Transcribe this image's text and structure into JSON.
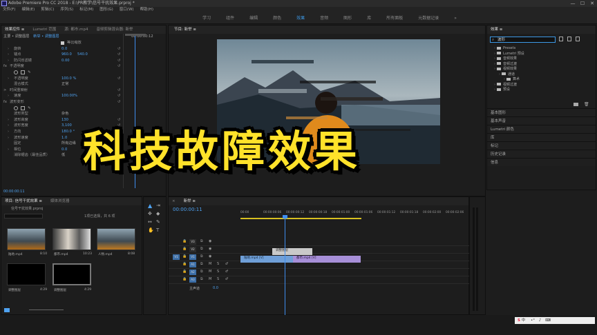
{
  "window": {
    "title": "Adobe Premiere Pro CC 2018 - E:\\PR教学\\信号干扰效果.prproj *",
    "controls": [
      "—",
      "☐",
      "✕"
    ]
  },
  "menu": [
    "文件(F)",
    "编辑(E)",
    "剪辑(C)",
    "序列(S)",
    "标记(M)",
    "图形(G)",
    "窗口(W)",
    "帮助(H)"
  ],
  "workspaces": {
    "items": [
      "学习",
      "组件",
      "编辑",
      "颜色",
      "效果",
      "音频",
      "图形",
      "库",
      "所有面板",
      "元数据记录"
    ],
    "active_index": 4,
    "more": "»"
  },
  "effect_controls": {
    "tabs": [
      "效果控件 ≡",
      "Lumetri 范围",
      "源: 都市.mp4",
      "音频剪辑混合器: 新举"
    ],
    "header_source": "主要 • 调整图层",
    "header_clip": "新举 • 调整图层",
    "header_time": "00:00:00:12",
    "rows": [
      {
        "label": "等比缩放",
        "type": "check"
      },
      {
        "label": "旋转",
        "value": "0.0",
        "arrow": true
      },
      {
        "label": "锚点",
        "value": "960.0",
        "value2": "540.0",
        "arrow": true
      },
      {
        "label": "防闪烁滤镜",
        "value": "0.00",
        "arrow": true
      },
      {
        "label": "不透明度",
        "section": true,
        "fx": "fx"
      },
      {
        "label": "shapes",
        "type": "shapes"
      },
      {
        "label": "不透明度",
        "value": "100.0 %",
        "arrow": true
      },
      {
        "label": "混合模式",
        "plain": "正常"
      },
      {
        "label": "时间重映射",
        "section": true,
        "fx": ">"
      },
      {
        "label": "速度",
        "value": "100.00%",
        "arrow": true
      },
      {
        "label": "波形变形",
        "section": true,
        "fx": "fx"
      },
      {
        "label": "shapes",
        "type": "shapes"
      },
      {
        "label": "波形类型",
        "plain": "杂色"
      },
      {
        "label": "波形高度",
        "value": "130",
        "arrow": true
      },
      {
        "label": "波形宽度",
        "value": "3,100",
        "arrow": true
      },
      {
        "label": "方向",
        "value": "180.0 °",
        "arrow": true
      },
      {
        "label": "波形速度",
        "value": "1.0",
        "arrow": true
      },
      {
        "label": "固定",
        "plain": "所有边缘"
      },
      {
        "label": "相位",
        "value": "0.0",
        "arrow": true
      },
      {
        "label": "消除锯齿（最佳品质）",
        "plain": "低"
      }
    ],
    "footer_time": "00:00:00:11"
  },
  "program_monitor": {
    "tab": "节目: 新举 ≡"
  },
  "project": {
    "tabs": [
      "项目: 信号干扰效果 ≡",
      "媒体浏览器"
    ],
    "file": "信号干扰效果.prproj",
    "selection": "1项已选择，共 6 项",
    "items": [
      {
        "name": "陆地.mp4",
        "dur": "8:10"
      },
      {
        "name": "都市.mp4",
        "dur": "10:23"
      },
      {
        "name": "人物.mp4",
        "dur": "8:08"
      },
      {
        "name": "调整图层",
        "dur": "4:29"
      },
      {
        "name": "调整图层",
        "dur": "4:29"
      }
    ]
  },
  "timeline": {
    "tab": "新举 ≡",
    "timecode": "00:00:00:11",
    "ruler": [
      "00:00",
      "00:00:00:06",
      "00:00:00:12",
      "00:00:00:18",
      "00:00:01:00",
      "00:00:01:06",
      "00:00:01:12",
      "00:00:01:18",
      "00:00:02:00",
      "00:00:02:06"
    ],
    "tracks": [
      {
        "name": "V3"
      },
      {
        "name": "V2"
      },
      {
        "name": "V1",
        "src": "V1"
      },
      {
        "name": "A1"
      },
      {
        "name": "A2"
      },
      {
        "name": "A3"
      }
    ],
    "master": "主声道",
    "master_val": "0.0",
    "clips": {
      "adjust": "调整图层",
      "v1a": "陆地.mp4 [V]",
      "v1b": "都市.mp4 [V]"
    }
  },
  "effects_panel": {
    "tab": "效果 ≡",
    "search": "波形",
    "tree": [
      {
        "label": "Presets",
        "indent": 0
      },
      {
        "label": "Lumetri 预设",
        "indent": 0
      },
      {
        "label": "音频效果",
        "indent": 0
      },
      {
        "label": "音频过渡",
        "indent": 0
      },
      {
        "label": "视频效果",
        "indent": 0
      },
      {
        "label": "通道",
        "indent": 1
      },
      {
        "label": "算术",
        "indent": 2
      },
      {
        "label": "视频过渡",
        "indent": 0
      },
      {
        "label": "预设",
        "indent": 0
      }
    ],
    "sections": [
      "基本图形",
      "基本声音",
      "Lumetri 颜色",
      "库",
      "标记",
      "历史记录",
      "信息"
    ]
  },
  "overlay": {
    "headline": "科技故障效果"
  },
  "colors": {
    "accent": "#3d9ae8",
    "headline": "#ffe22a",
    "playhead": "#3f8ef0",
    "clip_blue": "#6f9fd8",
    "clip_purple": "#a78fd8"
  },
  "taskbar": {
    "time": "15:42",
    "ime": "中"
  }
}
